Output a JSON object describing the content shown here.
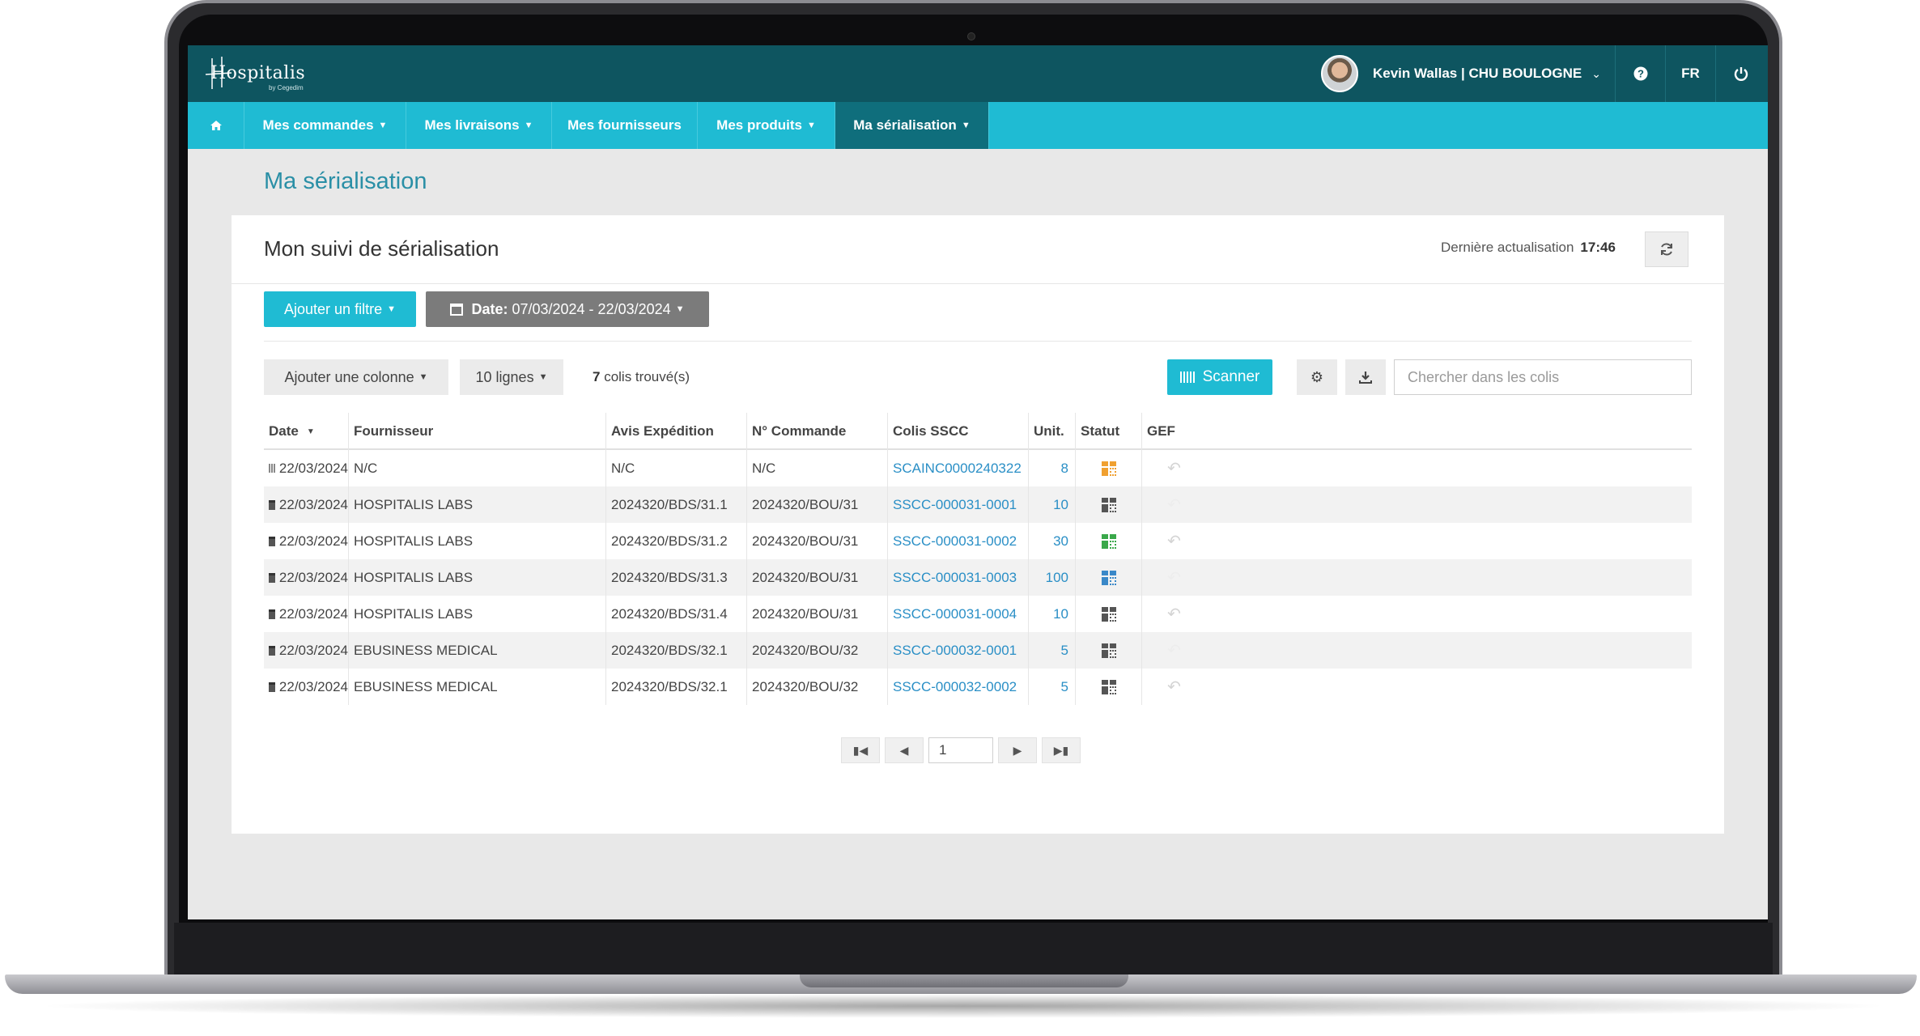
{
  "header": {
    "logo_text": "Hospitalis",
    "logo_sub": "by Cegedim",
    "user_label": "Kevin Wallas | CHU BOULOGNE",
    "help_icon": "question-circle-icon",
    "lang": "FR",
    "power_icon": "power-icon"
  },
  "nav": {
    "home_icon": "home-icon",
    "items": [
      {
        "label": "Mes commandes",
        "has_menu": true
      },
      {
        "label": "Mes livraisons",
        "has_menu": true
      },
      {
        "label": "Mes fournisseurs",
        "has_menu": false
      },
      {
        "label": "Mes produits",
        "has_menu": true
      },
      {
        "label": "Ma sérialisation",
        "has_menu": true,
        "active": true
      }
    ]
  },
  "page": {
    "title": "Ma sérialisation"
  },
  "card": {
    "title": "Mon suivi de sérialisation",
    "update_label": "Dernière actualisation",
    "update_time": "17:46",
    "refresh_icon": "refresh-icon"
  },
  "filters": {
    "add_filter": "Ajouter un filtre",
    "date_label": "Date:",
    "date_range": "07/03/2024 - 22/03/2024"
  },
  "toolbar": {
    "add_column": "Ajouter une colonne",
    "lines": "10 lignes",
    "found_count": "7",
    "found_label": "colis trouvé(s)",
    "scanner": "Scanner",
    "search_placeholder": "Chercher dans les colis"
  },
  "table": {
    "columns": [
      "Date",
      "Fournisseur",
      "Avis Expédition",
      "N° Commande",
      "Colis SSCC",
      "Unit.",
      "Statut",
      "GEF"
    ],
    "rows": [
      {
        "icon": "barcode-icon",
        "date": "22/03/2024",
        "supplier": "N/C",
        "shipping": "N/C",
        "order": "N/C",
        "sscc": "SCAINC0000240322",
        "units": "8",
        "status_color": "#f0a030",
        "gef": true
      },
      {
        "icon": "box-icon",
        "date": "22/03/2024",
        "supplier": "HOSPITALIS LABS",
        "shipping": "2024320/BDS/31.1",
        "order": "2024320/BOU/31",
        "sscc": "SSCC-000031-0001",
        "units": "10",
        "status_color": "#555555",
        "gef": false
      },
      {
        "icon": "box-icon",
        "date": "22/03/2024",
        "supplier": "HOSPITALIS LABS",
        "shipping": "2024320/BDS/31.2",
        "order": "2024320/BOU/31",
        "sscc": "SSCC-000031-0002",
        "units": "30",
        "status_color": "#3aa84a",
        "gef": true
      },
      {
        "icon": "box-icon",
        "date": "22/03/2024",
        "supplier": "HOSPITALIS LABS",
        "shipping": "2024320/BDS/31.3",
        "order": "2024320/BOU/31",
        "sscc": "SSCC-000031-0003",
        "units": "100",
        "status_color": "#3a88c8",
        "gef": false
      },
      {
        "icon": "box-icon",
        "date": "22/03/2024",
        "supplier": "HOSPITALIS LABS",
        "shipping": "2024320/BDS/31.4",
        "order": "2024320/BOU/31",
        "sscc": "SSCC-000031-0004",
        "units": "10",
        "status_color": "#555555",
        "gef": true
      },
      {
        "icon": "box-icon",
        "date": "22/03/2024",
        "supplier": "EBUSINESS MEDICAL",
        "shipping": "2024320/BDS/32.1",
        "order": "2024320/BOU/32",
        "sscc": "SSCC-000032-0001",
        "units": "5",
        "status_color": "#555555",
        "gef": false
      },
      {
        "icon": "box-icon",
        "date": "22/03/2024",
        "supplier": "EBUSINESS MEDICAL",
        "shipping": "2024320/BDS/32.1",
        "order": "2024320/BOU/32",
        "sscc": "SSCC-000032-0002",
        "units": "5",
        "status_color": "#555555",
        "gef": true
      }
    ]
  },
  "pager": {
    "page": "1"
  }
}
